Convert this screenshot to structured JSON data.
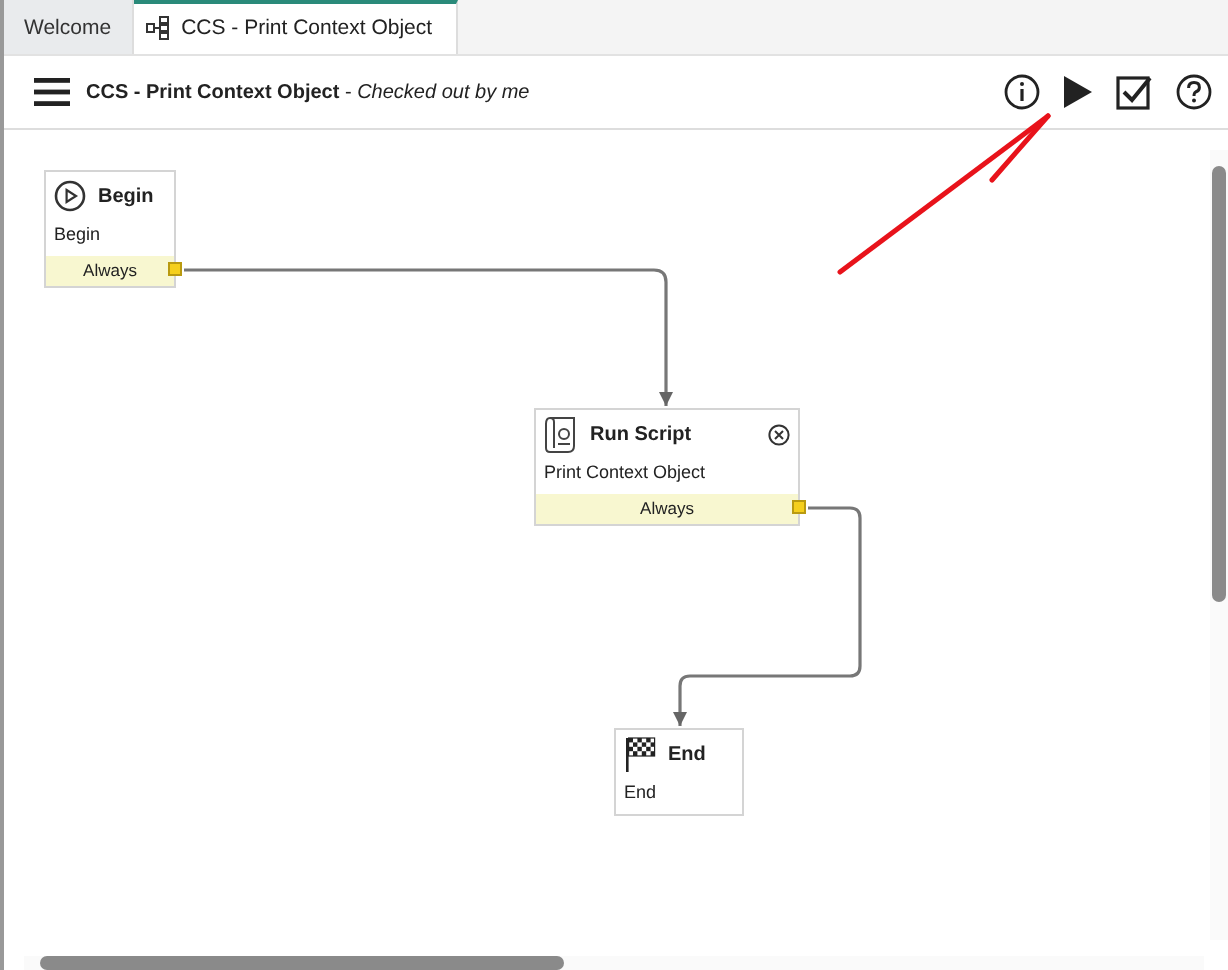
{
  "tabs": [
    {
      "label": "Welcome",
      "selected": false,
      "icon": false
    },
    {
      "label": "CCS - Print Context Object",
      "selected": true,
      "icon": true
    }
  ],
  "toolbar": {
    "title": "**CCS - Print Context Object** - *Checked out by me*"
  },
  "nodes": [
    {
      "kind": "begin",
      "title": "Begin",
      "label": "Begin",
      "output": "Always",
      "removable": false
    },
    {
      "kind": "script",
      "title": "Run Script",
      "label": "Print Context Object",
      "output": "Always",
      "removable": true
    },
    {
      "kind": "end",
      "title": "End",
      "label": "End",
      "removable": false
    }
  ]
}
